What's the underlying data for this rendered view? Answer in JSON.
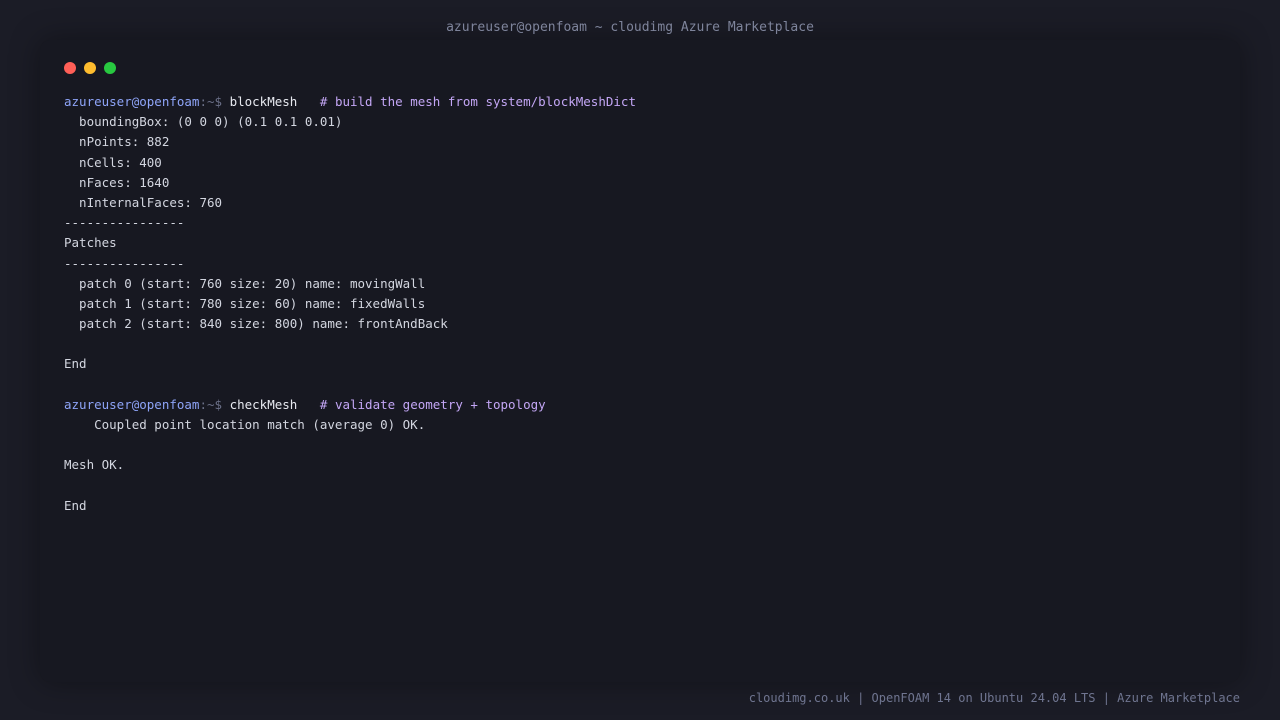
{
  "window": {
    "title": "azureuser@openfoam ~ cloudimg Azure Marketplace"
  },
  "terminal": {
    "prompt_user": "azureuser@openfoam",
    "prompt_path": ":~$ ",
    "lines": {
      "l1_cmd": "blockMesh",
      "l1_comment": "   # build the mesh from system/blockMeshDict",
      "l2": "  boundingBox: (0 0 0) (0.1 0.1 0.01)",
      "l3": "  nPoints: 882",
      "l4": "  nCells: 400",
      "l5": "  nFaces: 1640",
      "l6": "  nInternalFaces: 760",
      "l7": "----------------",
      "l8": "Patches",
      "l9": "----------------",
      "l10": "  patch 0 (start: 760 size: 20) name: movingWall",
      "l11": "  patch 1 (start: 780 size: 60) name: fixedWalls",
      "l12": "  patch 2 (start: 840 size: 800) name: frontAndBack",
      "l14": "End",
      "l16_cmd": "checkMesh",
      "l16_comment": "   # validate geometry + topology",
      "l17": "    Coupled point location match (average 0) OK.",
      "l19": "Mesh OK.",
      "l21": "End"
    }
  },
  "footer": {
    "text": "cloudimg.co.uk | OpenFOAM 14 on Ubuntu 24.04 LTS | Azure Marketplace"
  },
  "colors": {
    "background": "#1b1c26",
    "window": "#171821",
    "prompt_user": "#8ea4f8",
    "comment": "#c3a6f5"
  }
}
